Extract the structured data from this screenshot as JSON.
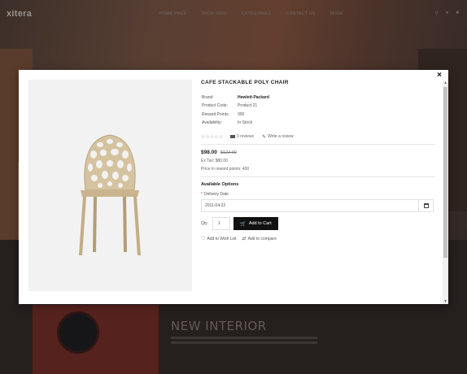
{
  "background": {
    "logo": "xitera",
    "nav": [
      "Home Page",
      "Shop Grid",
      "Categories",
      "Contact Us",
      "More"
    ],
    "section_title": "NEW INTERIOR"
  },
  "modal": {
    "close_label": "×",
    "product": {
      "title": "CAFE STACKABLE POLY CHAIR",
      "specs": [
        {
          "label": "Brand:",
          "value": "Hewlett-Packard"
        },
        {
          "label": "Product Code:",
          "value": "Product 21"
        },
        {
          "label": "Reward Points:",
          "value": "300"
        },
        {
          "label": "Availability:",
          "value": "In Stock"
        }
      ],
      "rating": 0,
      "stars": "☆☆☆☆☆",
      "reviews_label": "0 reviews",
      "write_review_label": "Write a review",
      "price": "$98.00",
      "old_price": "$122.00",
      "ex_tax": "Ex Tax: $80.00",
      "reward_price": "Price in reward points: 400"
    },
    "options": {
      "title": "Available Options",
      "delivery_label": "Delivery Date",
      "delivery_value": "2011-04-22"
    },
    "purchase": {
      "qty_label": "Qty",
      "qty_value": "1",
      "add_to_cart_label": "Add to Cart",
      "wishlist_label": "Add to Wish List",
      "compare_label": "Add to compare"
    }
  },
  "colors": {
    "cart_button": "#111111",
    "required": "#ee3333",
    "image_background": "#f2f2f2"
  }
}
